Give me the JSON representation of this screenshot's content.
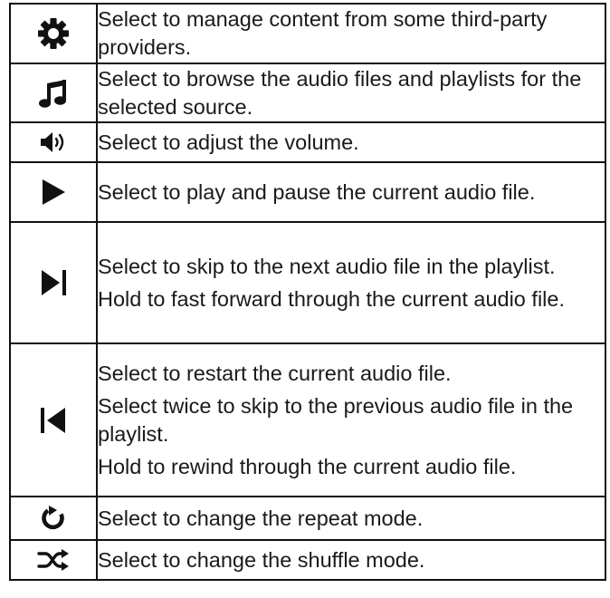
{
  "rows": [
    {
      "icon": "gear-icon",
      "lines": [
        "Select to manage content from some third-party providers."
      ]
    },
    {
      "icon": "music-note-icon",
      "lines": [
        "Select to browse the audio files and playlists for the selected source."
      ]
    },
    {
      "icon": "volume-icon",
      "lines": [
        "Select to adjust the volume."
      ]
    },
    {
      "icon": "play-icon",
      "lines": [
        "Select to play and pause the current audio file."
      ]
    },
    {
      "icon": "skip-next-icon",
      "lines": [
        "Select to skip to the next audio file in the playlist.",
        "Hold to fast forward through the current audio file."
      ]
    },
    {
      "icon": "skip-previous-icon",
      "lines": [
        "Select to restart the current audio file.",
        "Select twice to skip to the previous audio file in the playlist.",
        "Hold to rewind through the current audio file."
      ]
    },
    {
      "icon": "repeat-icon",
      "lines": [
        "Select to change the repeat mode."
      ]
    },
    {
      "icon": "shuffle-icon",
      "lines": [
        "Select to change the shuffle mode."
      ]
    }
  ]
}
